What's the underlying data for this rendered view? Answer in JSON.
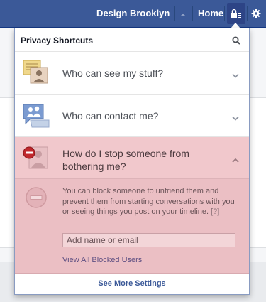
{
  "topbar": {
    "profile_name": "Design Brooklyn",
    "home_label": "Home",
    "bar_color": "#3b5998"
  },
  "flyout": {
    "title": "Privacy Shortcuts",
    "shortcuts": [
      {
        "label": "Who can see my stuff?",
        "icon": "lock-document-icon",
        "expanded": false
      },
      {
        "label": "Who can contact me?",
        "icon": "chat-people-icon",
        "expanded": false
      },
      {
        "label": "How do I stop someone from bothering me?",
        "icon": "block-person-icon",
        "expanded": true
      }
    ],
    "expanded_panel": {
      "description": "You can block someone to unfriend them and prevent them from starting conversations with you or seeing things you post on your timeline.",
      "help_link": "[?]",
      "input_placeholder": "Add name or email",
      "input_value": "",
      "blocked_users_link": "View All Blocked Users",
      "background_color": "#ebbfc4"
    },
    "footer_link": "See More Settings"
  }
}
